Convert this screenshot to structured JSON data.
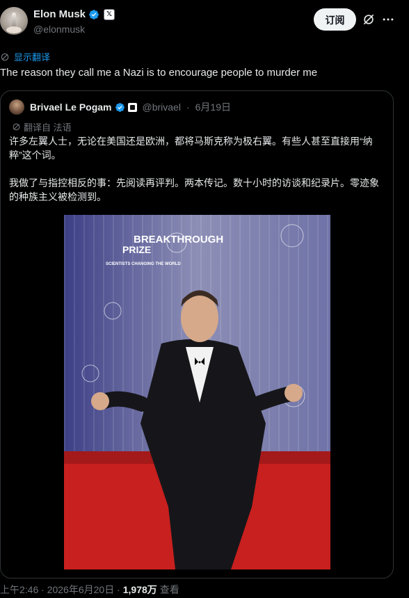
{
  "author": {
    "display_name": "Elon Musk",
    "handle": "@elonmusk",
    "badge_letter": "𝕏"
  },
  "actions": {
    "subscribe_label": "订阅"
  },
  "translation": {
    "show_translation_label": "显示翻译"
  },
  "tweet": {
    "text": "The reason they call me a Nazi is to encourage people to murder me"
  },
  "quoted": {
    "display_name": "Brivael Le Pogam",
    "handle": "@brivael",
    "separator": "·",
    "date": "6月19日",
    "translated_from": "翻译自 法语",
    "text": "许多左翼人士，无论在美国还是欧洲，都将马斯克称为极右翼。有些人甚至直接用“纳粹”这个词。\n\n我做了与指控相反的事：先阅读再评判。两本传记。数十小时的访谈和纪录片。零迹象的种族主义被检测到。",
    "photo": {
      "backdrop_text_line1": "BREAKTHROUGH",
      "backdrop_text_line2": "PRIZE",
      "backdrop_small": "SCIENTISTS CHANGING THE WORLD"
    }
  },
  "footer": {
    "time": "上午2:46 · 2026年6月20日 ·",
    "views": "1,978万",
    "views_label": "查看"
  },
  "colors": {
    "background": "#000000",
    "text": "#e7e9ea",
    "muted": "#71767b",
    "link": "#1d9bf0",
    "verified": "#1d9bf0",
    "carpet": "#c8201e"
  }
}
